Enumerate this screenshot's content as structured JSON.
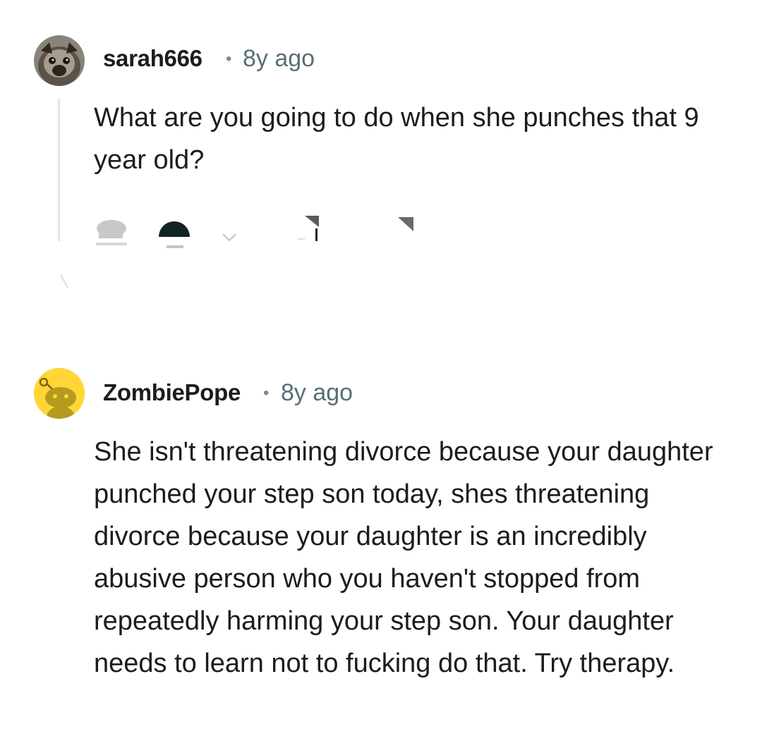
{
  "comments": [
    {
      "username": "sarah666",
      "separator": "•",
      "age": "8y ago",
      "body": "What are you going to do when she punches that 9 year old?"
    },
    {
      "username": "ZombiePope",
      "separator": "•",
      "age": "8y ago",
      "body": "She isn't threatening divorce because your daughter punched your step son today, shes threatening divorce because your daughter is an incredibly abusive person who you haven't stopped from repeatedly harming your step son. Your daughter needs to learn not to fucking do that. Try therapy."
    }
  ],
  "icons": {
    "avatar_1": "pug-avatar-icon",
    "avatar_2": "snoo-avatar-icon",
    "action_1": "upvote-icon",
    "action_2": "downvote-icon",
    "action_3": "chevron-down-icon",
    "action_4": "reply-icon",
    "action_5": "share-icon"
  },
  "colors": {
    "username": "#1c1c1c",
    "meta": "#576f76",
    "snoo_background": "#ffd635",
    "thread_line": "#e5e5e5"
  }
}
